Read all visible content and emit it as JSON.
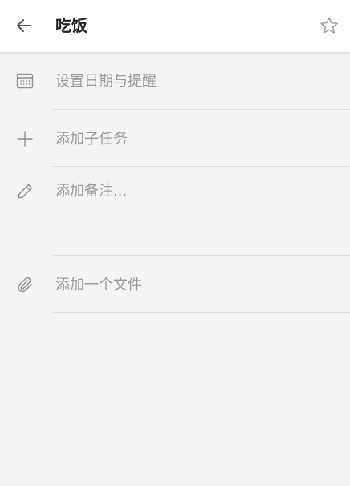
{
  "header": {
    "title": "吃饭",
    "back_icon": "arrow-left-icon",
    "star_icon": "star-outline-icon"
  },
  "rows": {
    "due_date": {
      "label": "设置日期与提醒",
      "icon": "calendar-icon"
    },
    "subtask": {
      "label": "添加子任务",
      "icon": "plus-icon"
    },
    "note": {
      "label": "添加备注...",
      "icon": "pencil-icon"
    },
    "file": {
      "label": "添加一个文件",
      "icon": "paperclip-icon"
    }
  },
  "colors": {
    "background": "#f4f4f4",
    "header_background": "#ffffff",
    "title_text": "#222222",
    "muted_text": "#9a9a9a",
    "icon_gray": "#8f8f8f",
    "divider": "#dcdcdc"
  }
}
